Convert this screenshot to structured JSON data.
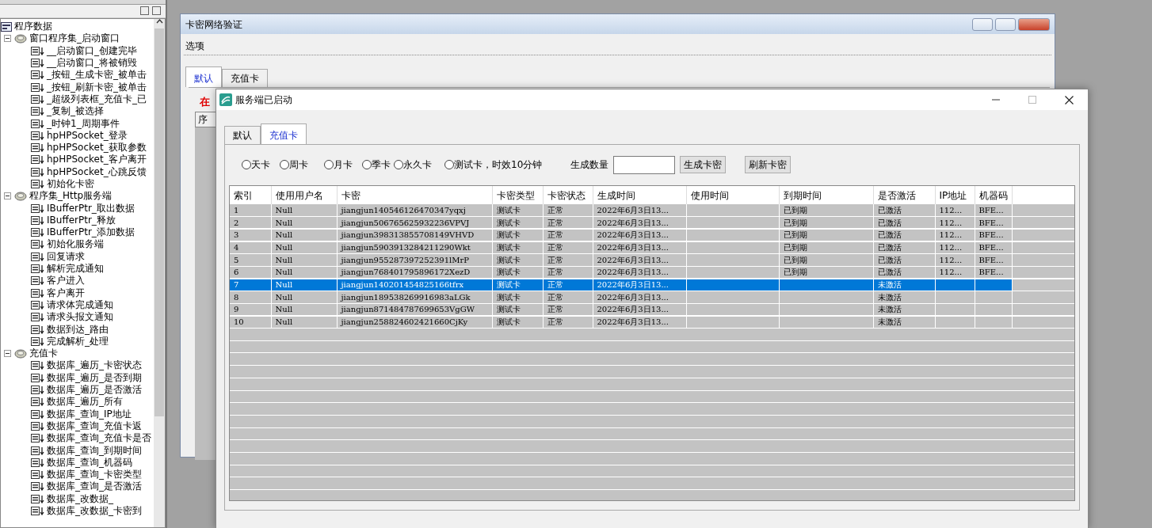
{
  "project_panel": {
    "tree": {
      "label": "程序数据",
      "children": [
        {
          "label": "窗口程序集_启动窗口",
          "expanded": true,
          "children": [
            {
              "label": "__启动窗口_创建完毕"
            },
            {
              "label": "__启动窗口_将被销毁"
            },
            {
              "label": "_按钮_生成卡密_被单击"
            },
            {
              "label": "_按钮_刷新卡密_被单击"
            },
            {
              "label": "_超级列表框_充值卡_已"
            },
            {
              "label": "_复制_被选择"
            },
            {
              "label": "_时钟1_周期事件"
            },
            {
              "label": "hpHPSocket_登录"
            },
            {
              "label": "hpHPSocket_获取参数"
            },
            {
              "label": "hpHPSocket_客户离开"
            },
            {
              "label": "hpHPSocket_心跳反馈"
            },
            {
              "label": "初始化卡密"
            }
          ]
        },
        {
          "label": "程序集_Http服务端",
          "expanded": true,
          "children": [
            {
              "label": "IBufferPtr_取出数据"
            },
            {
              "label": "IBufferPtr_释放"
            },
            {
              "label": "IBufferPtr_添加数据"
            },
            {
              "label": "初始化服务端"
            },
            {
              "label": "回复请求"
            },
            {
              "label": "解析完成通知"
            },
            {
              "label": "客户进入"
            },
            {
              "label": "客户离开"
            },
            {
              "label": "请求体完成通知"
            },
            {
              "label": "请求头报文通知"
            },
            {
              "label": "数据到达_路由"
            },
            {
              "label": "完成解析_处理"
            }
          ]
        },
        {
          "label": "充值卡",
          "expanded": true,
          "children": [
            {
              "label": "数据库_遍历_卡密状态"
            },
            {
              "label": "数据库_遍历_是否到期"
            },
            {
              "label": "数据库_遍历_是否激活"
            },
            {
              "label": "数据库_遍历_所有"
            },
            {
              "label": "数据库_查询_IP地址"
            },
            {
              "label": "数据库_查询_充值卡返"
            },
            {
              "label": "数据库_查询_充值卡是否"
            },
            {
              "label": "数据库_查询_到期时间"
            },
            {
              "label": "数据库_查询_机器码"
            },
            {
              "label": "数据库_查询_卡密类型"
            },
            {
              "label": "数据库_查询_是否激活"
            },
            {
              "label": "数据库_改数据_"
            },
            {
              "label": "数据库_改数据_卡密到"
            }
          ]
        }
      ]
    }
  },
  "back_window": {
    "title": "卡密网络验证",
    "menu": [
      "选项"
    ],
    "tabs": [
      {
        "label": "默认",
        "selected": true
      },
      {
        "label": "充值卡",
        "selected": false
      }
    ],
    "status_text": "在",
    "table_header": "序"
  },
  "dialog": {
    "title": "服务端已启动",
    "tabs": [
      {
        "label": "默认",
        "selected": false
      },
      {
        "label": "充值卡",
        "selected": true
      }
    ],
    "card_types": [
      {
        "label": "天卡",
        "selected": false
      },
      {
        "label": "周卡",
        "selected": false
      },
      {
        "label": "月卡",
        "selected": false
      },
      {
        "label": "季卡",
        "selected": false
      },
      {
        "label": "永久卡",
        "selected": false
      },
      {
        "label": "测试卡，时效10分钟",
        "selected": false
      }
    ],
    "quantity_label": "生成数量",
    "buttons": [
      "生成卡密",
      "刷新卡密"
    ],
    "table": {
      "columns": [
        "索引",
        "使用用户名",
        "卡密",
        "卡密类型",
        "卡密状态",
        "生成时间",
        "使用时间",
        "到期时间",
        "是否激活",
        "IP地址",
        "机器码"
      ],
      "rows": [
        {
          "selected": false,
          "cells": [
            "1",
            "Null",
            "jiangjun140546126470347yqxj",
            "测试卡",
            "正常",
            "2022年6月3日13...",
            null,
            "已到期",
            "已激活",
            "112...",
            "BFE..."
          ]
        },
        {
          "selected": false,
          "cells": [
            "2",
            "Null",
            "jiangjun506765625932236VPVJ",
            "测试卡",
            "正常",
            "2022年6月3日13...",
            null,
            "已到期",
            "已激活",
            "112...",
            "BFE..."
          ]
        },
        {
          "selected": false,
          "cells": [
            "3",
            "Null",
            "jiangjun398313855708149VHVD",
            "测试卡",
            "正常",
            "2022年6月3日13...",
            null,
            "已到期",
            "已激活",
            "112...",
            "BFE..."
          ]
        },
        {
          "selected": false,
          "cells": [
            "4",
            "Null",
            "jiangjun5903913284211290Wkt",
            "测试卡",
            "正常",
            "2022年6月3日13...",
            null,
            "已到期",
            "已激活",
            "112...",
            "BFE..."
          ]
        },
        {
          "selected": false,
          "cells": [
            "5",
            "Null",
            "jiangjun955287397252391lMrP",
            "测试卡",
            "正常",
            "2022年6月3日13...",
            null,
            "已到期",
            "已激活",
            "112...",
            "BFE..."
          ]
        },
        {
          "selected": false,
          "cells": [
            "6",
            "Null",
            "jiangjun768401795896172XezD",
            "测试卡",
            "正常",
            "2022年6月3日13...",
            null,
            "已到期",
            "已激活",
            "112...",
            "BFE..."
          ]
        },
        {
          "selected": true,
          "cells": [
            "7",
            "Null",
            "jiangjun140201454825166tfrx",
            "测试卡",
            "正常",
            "2022年6月3日13...",
            null,
            null,
            "未激活",
            null,
            null
          ]
        },
        {
          "selected": false,
          "cells": [
            "8",
            "Null",
            "jiangjun189538269916983aLGk",
            "测试卡",
            "正常",
            "2022年6月3日13...",
            null,
            null,
            "未激活",
            null,
            null
          ]
        },
        {
          "selected": false,
          "cells": [
            "9",
            "Null",
            "jiangjun871484787699653VgGW",
            "测试卡",
            "正常",
            "2022年6月3日13...",
            null,
            null,
            "未激活",
            null,
            null
          ]
        },
        {
          "selected": false,
          "cells": [
            "10",
            "Null",
            "jiangjun258824602421660CjKy",
            "测试卡",
            "正常",
            "2022年6月3日13...",
            null,
            null,
            "未激活",
            null,
            null
          ]
        }
      ]
    }
  }
}
